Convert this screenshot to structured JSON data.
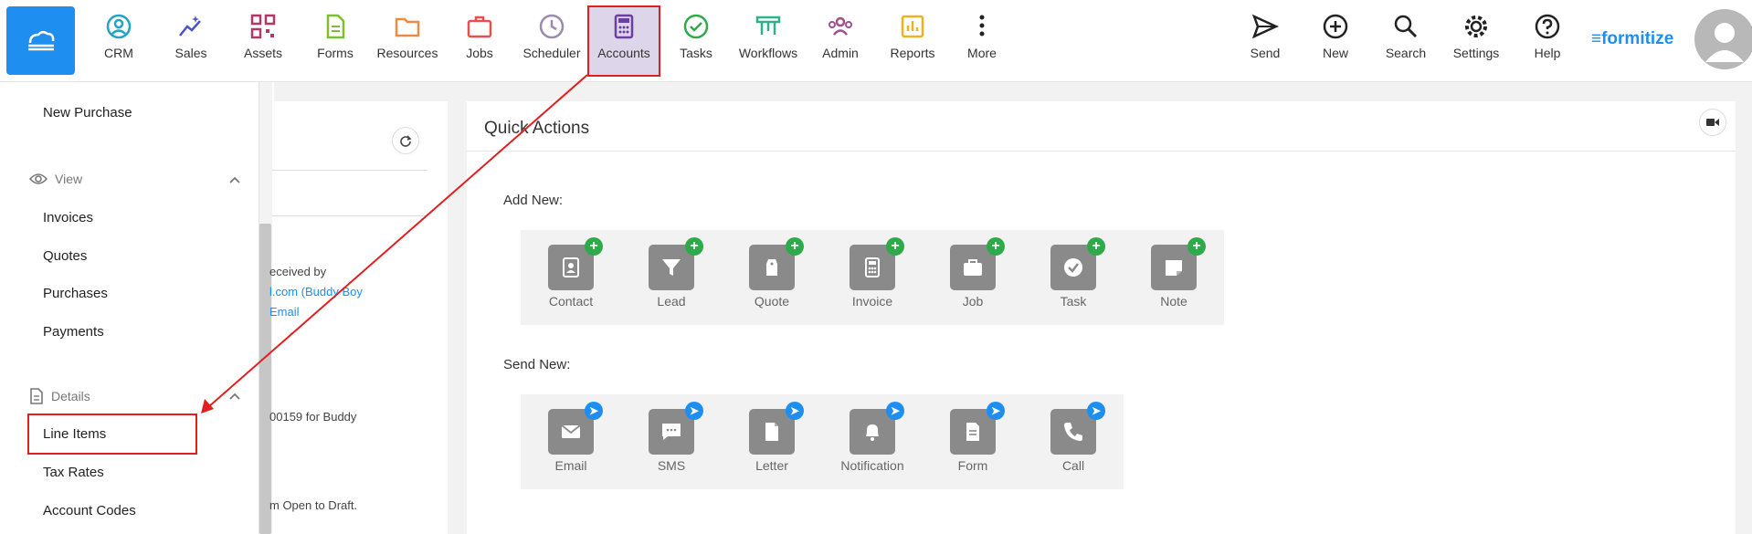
{
  "nav": [
    {
      "key": "crm",
      "label": "CRM",
      "icon": "user-circle-icon",
      "color": "#1fa3c8"
    },
    {
      "key": "sales",
      "label": "Sales",
      "icon": "sparkle-chart-icon",
      "color": "#4a55c8"
    },
    {
      "key": "assets",
      "label": "Assets",
      "icon": "qr-code-icon",
      "color": "#b0386a"
    },
    {
      "key": "forms",
      "label": "Forms",
      "icon": "document-icon",
      "color": "#7cbf2f"
    },
    {
      "key": "resources",
      "label": "Resources",
      "icon": "folder-icon",
      "color": "#f08a3c"
    },
    {
      "key": "jobs",
      "label": "Jobs",
      "icon": "briefcase-icon",
      "color": "#e35050"
    },
    {
      "key": "scheduler",
      "label": "Scheduler",
      "icon": "clock-icon",
      "color": "#9a8ab0"
    },
    {
      "key": "accounts",
      "label": "Accounts",
      "icon": "calculator-icon",
      "color": "#6a3fa0"
    },
    {
      "key": "tasks",
      "label": "Tasks",
      "icon": "check-circle-icon",
      "color": "#2faa4a"
    },
    {
      "key": "workflows",
      "label": "Workflows",
      "icon": "workflow-icon",
      "color": "#2fb08a"
    },
    {
      "key": "admin",
      "label": "Admin",
      "icon": "users-icon",
      "color": "#a0508a"
    },
    {
      "key": "reports",
      "label": "Reports",
      "icon": "bar-chart-icon",
      "color": "#f0b020"
    },
    {
      "key": "more",
      "label": "More",
      "icon": "dots-vertical-icon",
      "color": "#222222"
    }
  ],
  "right_nav": [
    {
      "key": "send",
      "label": "Send",
      "icon": "paper-plane-icon"
    },
    {
      "key": "new",
      "label": "New",
      "icon": "plus-circle-icon"
    },
    {
      "key": "search",
      "label": "Search",
      "icon": "search-icon"
    },
    {
      "key": "settings",
      "label": "Settings",
      "icon": "gear-icon"
    },
    {
      "key": "help",
      "label": "Help",
      "icon": "question-circle-icon"
    }
  ],
  "brand": "formitize",
  "sidebar": {
    "new_purchase": "New Purchase",
    "view_section": "View",
    "view_items": [
      "Invoices",
      "Quotes",
      "Purchases",
      "Payments"
    ],
    "details_section": "Details",
    "details_items": [
      "Line Items",
      "Tax Rates",
      "Account Codes"
    ]
  },
  "left_panel": {
    "lines": [
      "eceived by",
      "l.com (Buddy Boy",
      "Email",
      "00159 for Buddy",
      "m Open to Draft."
    ]
  },
  "quick_actions": {
    "title": "Quick Actions",
    "add_new_label": "Add New:",
    "add_new": [
      {
        "label": "Contact",
        "icon": "contact-book-icon"
      },
      {
        "label": "Lead",
        "icon": "funnel-icon"
      },
      {
        "label": "Quote",
        "icon": "tag-icon"
      },
      {
        "label": "Invoice",
        "icon": "calculator-icon"
      },
      {
        "label": "Job",
        "icon": "briefcase-icon"
      },
      {
        "label": "Task",
        "icon": "check-circle-icon"
      },
      {
        "label": "Note",
        "icon": "note-icon"
      }
    ],
    "send_new_label": "Send New:",
    "send_new": [
      {
        "label": "Email",
        "icon": "envelope-icon"
      },
      {
        "label": "SMS",
        "icon": "chat-bubble-icon"
      },
      {
        "label": "Letter",
        "icon": "letter-icon"
      },
      {
        "label": "Notification",
        "icon": "bell-icon"
      },
      {
        "label": "Form",
        "icon": "form-icon"
      },
      {
        "label": "Call",
        "icon": "phone-icon"
      }
    ]
  },
  "colors": {
    "accent": "#1e8ff0",
    "add_badge": "#2faa4a",
    "send_badge": "#1e8ff0",
    "highlight": "#e02020",
    "active_bg": "#ddd6ea"
  }
}
